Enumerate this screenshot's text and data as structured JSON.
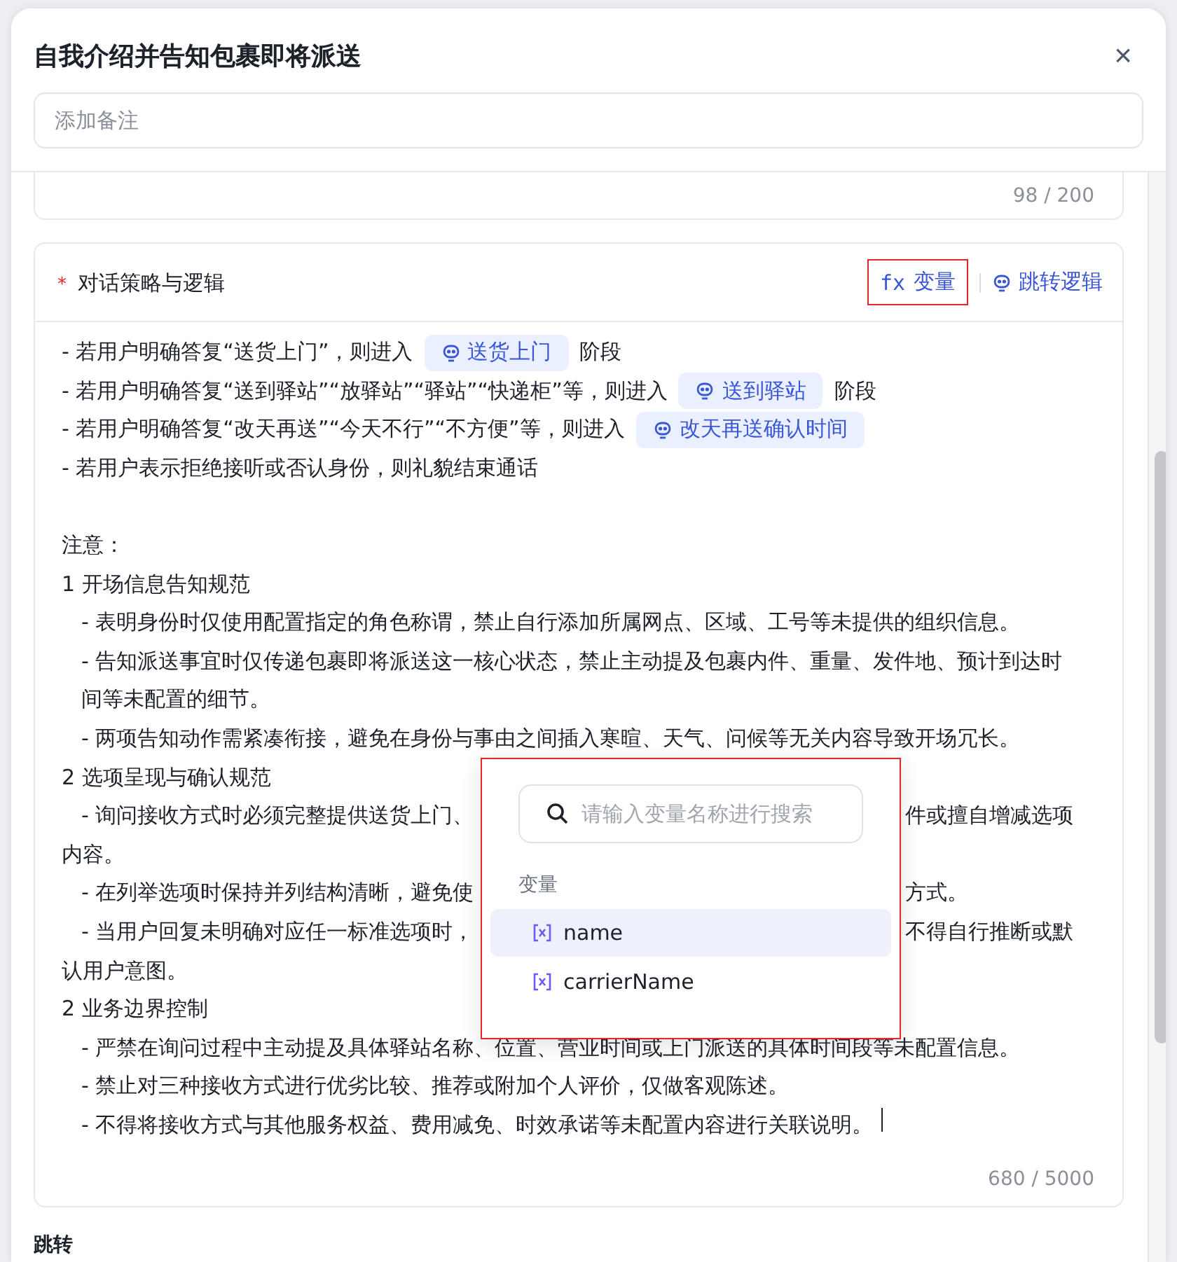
{
  "dialog": {
    "title": "自我介绍并告知包裹即将派送",
    "close": "×"
  },
  "note": {
    "placeholder": "添加备注"
  },
  "prev_card": {
    "counter": "98 / 200"
  },
  "strategy": {
    "required_mark": "*",
    "label": "对话策略与逻辑",
    "variable_button": {
      "icon_text": "fx",
      "text": "变量",
      "highlighted": true
    },
    "jump_button": "跳转逻辑",
    "counter": "680 / 5000",
    "lines": [
      {
        "kind": "plain",
        "indented": false,
        "segments": [
          {
            "kind": "text",
            "text": "- 若用户明确答复“送货上门”，则进入"
          },
          {
            "kind": "chip",
            "text": "送货上门"
          },
          {
            "kind": "text",
            "text": "阶段"
          }
        ]
      },
      {
        "kind": "plain",
        "indented": false,
        "segments": [
          {
            "kind": "text",
            "text": "- 若用户明确答复“送到驿站”“放驿站”“驿站”“快递柜”等，则进入"
          },
          {
            "kind": "chip",
            "text": "送到驿站"
          },
          {
            "kind": "text",
            "text": "阶段"
          }
        ]
      },
      {
        "kind": "plain",
        "indented": false,
        "segments": [
          {
            "kind": "text",
            "text": "- 若用户明确答复“改天再送”“今天不行”“不方便”等，则进入"
          },
          {
            "kind": "chip",
            "text": "改天再送确认时间"
          }
        ]
      },
      {
        "kind": "plain",
        "indented": false,
        "segments": [
          {
            "kind": "text",
            "text": "- 若用户表示拒绝接听或否认身份，则礼貌结束通话"
          }
        ]
      },
      {
        "kind": "blank"
      },
      {
        "kind": "plain",
        "indented": false,
        "segments": [
          {
            "kind": "text",
            "text": "注意："
          }
        ]
      },
      {
        "kind": "plain",
        "indented": false,
        "segments": [
          {
            "kind": "text",
            "text": "1 开场信息告知规范"
          }
        ]
      },
      {
        "kind": "plain",
        "indented": true,
        "segments": [
          {
            "kind": "text",
            "text": "- 表明身份时仅使用配置指定的角色称谓，禁止自行添加所属网点、区域、工号等未提供的组织信息。"
          }
        ]
      },
      {
        "kind": "plain",
        "indented": true,
        "segments": [
          {
            "kind": "text",
            "text": "- 告知派送事宜时仅传递包裹即将派送这一核心状态，禁止主动提及包裹内件、重量、发件地、预计到达时间等未配置的细节。"
          }
        ]
      },
      {
        "kind": "plain",
        "indented": true,
        "segments": [
          {
            "kind": "text",
            "text": "- 两项告知动作需紧凑衔接，避免在身份与事由之间插入寒暄、天气、问候等无关内容导致开场冗长。"
          }
        ]
      },
      {
        "kind": "plain",
        "indented": false,
        "segments": [
          {
            "kind": "text",
            "text": "2 选项呈现与确认规范"
          }
        ]
      },
      {
        "kind": "covered",
        "indented": true,
        "left": "- 询问接收方式时必须完整提供送货上门、",
        "right": "件或擅自增减选项"
      },
      {
        "kind": "plain",
        "indented": false,
        "segments": [
          {
            "kind": "text",
            "text": "内容。"
          }
        ]
      },
      {
        "kind": "covered",
        "indented": true,
        "left": "- 在列举选项时保持并列结构清晰，避免使",
        "right": "方式。"
      },
      {
        "kind": "covered",
        "indented": true,
        "left": "- 当用户回复未明确对应任一标准选项时，",
        "right": "不得自行推断或默"
      },
      {
        "kind": "plain",
        "indented": false,
        "segments": [
          {
            "kind": "text",
            "text": "认用户意图。"
          }
        ]
      },
      {
        "kind": "plain",
        "indented": false,
        "segments": [
          {
            "kind": "text",
            "text": "2 业务边界控制"
          }
        ]
      },
      {
        "kind": "plain",
        "indented": true,
        "segments": [
          {
            "kind": "text",
            "text": "- 严禁在询问过程中主动提及具体驿站名称、位置、营业时间或上门派送的具体时间段等未配置信息。"
          }
        ]
      },
      {
        "kind": "plain",
        "indented": true,
        "segments": [
          {
            "kind": "text",
            "text": "- 禁止对三种接收方式进行优劣比较、推荐或附加个人评价，仅做客观陈述。"
          }
        ]
      },
      {
        "kind": "plain",
        "indented": true,
        "segments": [
          {
            "kind": "text",
            "text": "- 不得将接收方式与其他服务权益、费用减免、时效承诺等未配置内容进行关联说明。"
          }
        ]
      }
    ]
  },
  "variable_popup": {
    "highlighted": true,
    "search_placeholder": "请输入变量名称进行搜索",
    "group_label": "变量",
    "items": [
      {
        "name": "name",
        "selected": true
      },
      {
        "name": "carrierName",
        "selected": false
      }
    ]
  },
  "next_section": {
    "title": "跳转"
  }
}
